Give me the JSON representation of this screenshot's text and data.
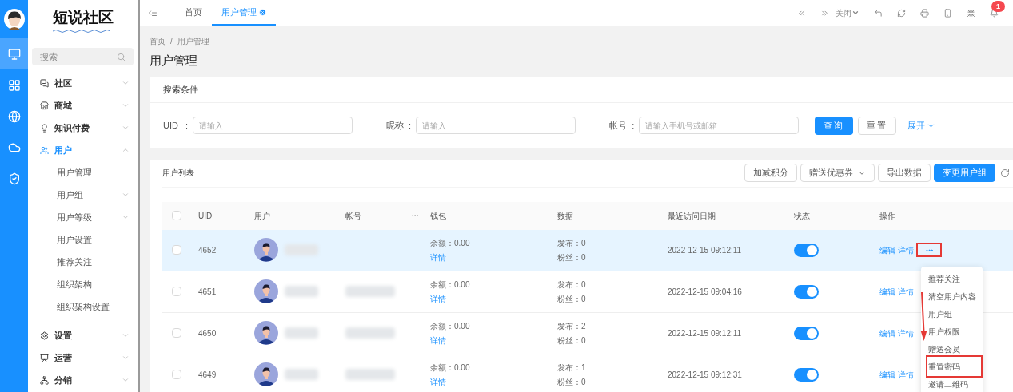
{
  "rail": [
    {
      "kind": "monitor",
      "selected": true
    },
    {
      "kind": "grid",
      "selected": false
    },
    {
      "kind": "globe",
      "selected": false
    },
    {
      "kind": "cloud",
      "selected": false
    },
    {
      "kind": "shield",
      "selected": false
    }
  ],
  "logo": {
    "title": "短说社区"
  },
  "sidebar": {
    "search": {
      "placeholder": "搜索"
    },
    "menu": [
      {
        "label": "社区",
        "kind": "chat",
        "expanded": false
      },
      {
        "label": "商城",
        "kind": "store",
        "expanded": false
      },
      {
        "label": "知识付费",
        "kind": "bulb",
        "expanded": false
      },
      {
        "label": "用户",
        "kind": "users",
        "expanded": true,
        "children": [
          {
            "label": "用户管理"
          },
          {
            "label": "用户组",
            "expanded": false
          },
          {
            "label": "用户等级",
            "expanded": false
          },
          {
            "label": "用户设置"
          },
          {
            "label": "推荐关注"
          },
          {
            "label": "组织架构"
          },
          {
            "label": "组织架构设置"
          }
        ]
      },
      {
        "label": "设置",
        "kind": "gear",
        "expanded": false
      },
      {
        "label": "运营",
        "kind": "board",
        "expanded": false
      },
      {
        "label": "分销",
        "kind": "network",
        "expanded": false
      }
    ]
  },
  "tabs": [
    {
      "label": "首页",
      "selected": false
    },
    {
      "label": "用户管理",
      "selected": true
    }
  ],
  "toolbar": {
    "close_menu": "关闭",
    "notifications": "1"
  },
  "breadcrumb": [
    "首页",
    "用户管理"
  ],
  "breadcrumb_separator": "/",
  "page_title": "用户管理",
  "search_panel": {
    "title": "搜索条件",
    "fields": [
      {
        "label": "UID",
        "colon": ":",
        "placeholder": "请输入"
      },
      {
        "label": "昵称",
        "colon": ":",
        "placeholder": "请输入"
      },
      {
        "label": "帐号",
        "colon": ":",
        "placeholder": "请输入手机号或邮箱"
      }
    ],
    "query": "查询",
    "reset": "重置",
    "expand": "展开"
  },
  "list": {
    "title": "用户列表",
    "buttons": [
      {
        "label": "加减积分",
        "kind": "default"
      },
      {
        "label": "赠送优惠券",
        "kind": "dropdown"
      },
      {
        "label": "导出数据",
        "kind": "default"
      },
      {
        "label": "变更用户组",
        "kind": "primary"
      }
    ],
    "all_checked": false,
    "columns": [
      "UID",
      "用户",
      "帐号",
      "钱包",
      "数据",
      "最近访问日期",
      "状态",
      "操作"
    ],
    "rows": [
      {
        "uid": "4652",
        "account": "-",
        "balance": "余额：0.00",
        "wallet_link": "详情",
        "posts": "发布：0",
        "fans": "粉丝：0",
        "date": "2022-12-15 09:12:11",
        "on": true,
        "actions": [
          "编辑",
          "详情"
        ],
        "highlighted": true,
        "more": true
      },
      {
        "uid": "4651",
        "balance": "余额：0.00",
        "wallet_link": "详情",
        "posts": "发布：0",
        "fans": "粉丝：0",
        "date": "2022-12-15 09:04:16",
        "on": true,
        "actions": [
          "编辑",
          "详情"
        ],
        "highlighted": false,
        "more": false
      },
      {
        "uid": "4650",
        "balance": "余额：0.00",
        "wallet_link": "详情",
        "posts": "发布：2",
        "fans": "粉丝：0",
        "date": "2022-12-15 09:12:11",
        "on": true,
        "actions": [
          "编辑",
          "详情"
        ],
        "highlighted": false,
        "more": false
      },
      {
        "uid": "4649",
        "balance": "余额：0.00",
        "wallet_link": "详情",
        "posts": "发布：1",
        "fans": "粉丝：0",
        "date": "2022-12-15 09:12:31",
        "on": true,
        "actions": [
          "编辑",
          "详情"
        ],
        "highlighted": false,
        "more": false
      }
    ]
  },
  "more_menu": [
    {
      "label": "推荐关注",
      "marked": false
    },
    {
      "label": "清空用户内容",
      "marked": false
    },
    {
      "label": "用户组",
      "marked": false
    },
    {
      "label": "用户权限",
      "marked": false
    },
    {
      "label": "赠送会员",
      "marked": false
    },
    {
      "label": "重置密码",
      "marked": true
    },
    {
      "label": "邀请二维码",
      "marked": false
    }
  ]
}
